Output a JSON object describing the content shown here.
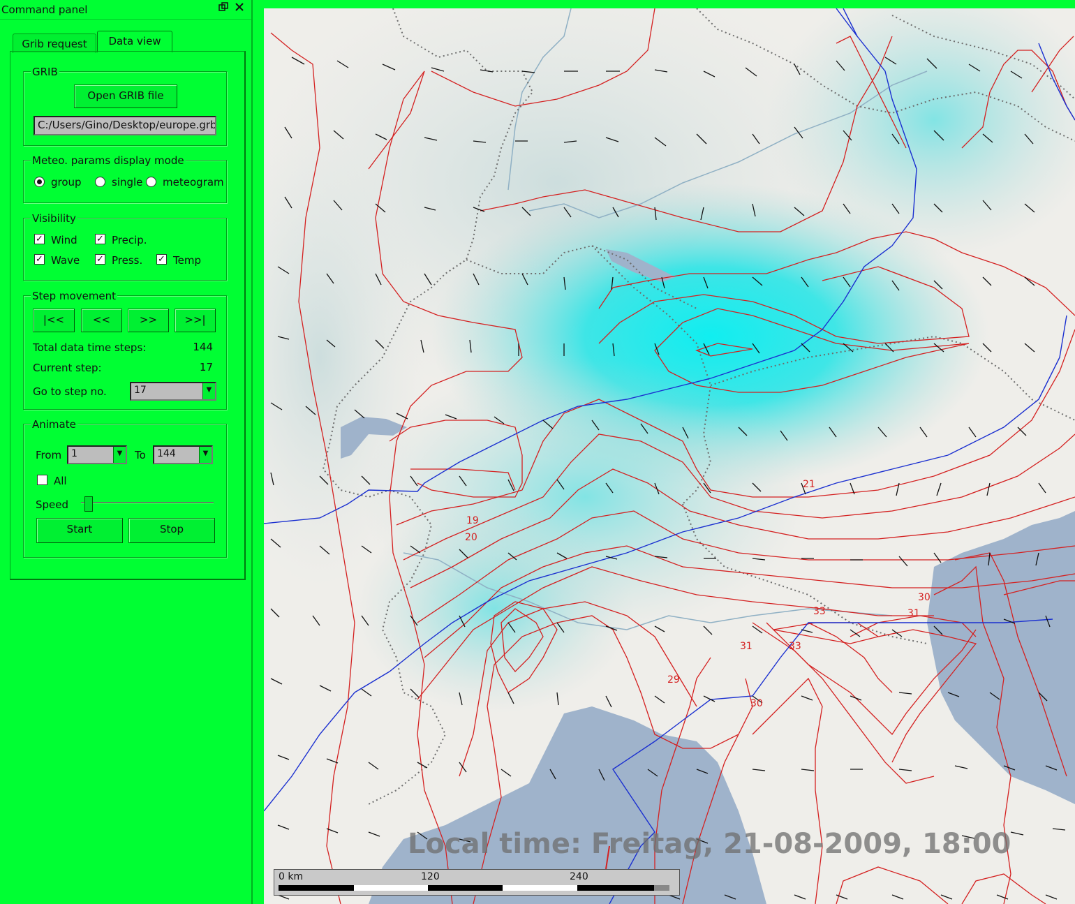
{
  "panel": {
    "title": "Command panel",
    "float_icon": "float-window-icon",
    "close_icon": "close-icon",
    "tabs": [
      {
        "label": "Grib request",
        "active": false
      },
      {
        "label": "Data view",
        "active": true
      }
    ]
  },
  "grib": {
    "group_title": "GRIB",
    "open_button": "Open GRIB file",
    "file_path": "C:/Users/Gino/Desktop/europe.grb"
  },
  "display_mode": {
    "group_title": "Meteo. params display mode",
    "options": [
      "group",
      "single",
      "meteogram"
    ],
    "selected": "group"
  },
  "visibility": {
    "group_title": "Visibility",
    "items": [
      {
        "label": "Wind",
        "checked": true
      },
      {
        "label": "Precip.",
        "checked": true
      },
      {
        "label": "Wave",
        "checked": true
      },
      {
        "label": "Press.",
        "checked": true
      },
      {
        "label": "Temp",
        "checked": true
      }
    ]
  },
  "step": {
    "group_title": "Step movement",
    "buttons": [
      "|<<",
      "<<",
      ">>",
      ">>|"
    ],
    "total_label": "Total data time steps:",
    "total_value": "144",
    "current_label": "Current step:",
    "current_value": "17",
    "goto_label": "Go to step no.",
    "goto_value": "17"
  },
  "animate": {
    "group_title": "Animate",
    "from_label": "From",
    "from_value": "1",
    "to_label": "To",
    "to_value": "144",
    "all_label": "All",
    "all_checked": false,
    "speed_label": "Speed",
    "speed_fraction": 0.03,
    "start_button": "Start",
    "stop_button": "Stop"
  },
  "map": {
    "local_time": "Local time: Freitag, 21-08-2009, 18:00",
    "scale_labels": [
      "0 km",
      "120",
      "240"
    ],
    "contour_labels": [
      "19",
      "20",
      "21",
      "29",
      "30",
      "30",
      "31",
      "31",
      "33",
      "33",
      "30"
    ],
    "colors": {
      "land": "#efeeea",
      "sea": "#9fb3cb",
      "isotherm": "#d42020",
      "front": "#1a2fd0",
      "precip": "#12ecee",
      "border": "#707070"
    }
  }
}
